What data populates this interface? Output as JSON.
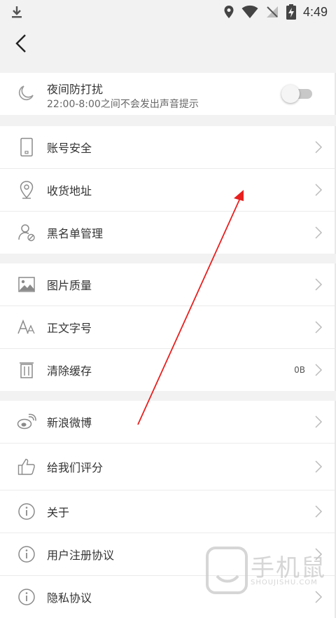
{
  "status_bar": {
    "time": "4:49",
    "icons": [
      "download-icon",
      "location-icon",
      "wifi-icon",
      "no-sim-icon",
      "battery-charging-icon"
    ]
  },
  "header": {
    "back_icon": "chevron-left-icon"
  },
  "night_mode": {
    "title": "夜间防打扰",
    "subtitle": "22:00-8:00之间不会发出声音提示",
    "enabled": false
  },
  "group1": [
    {
      "label": "账号安全",
      "icon": "phone-icon"
    },
    {
      "label": "收货地址",
      "icon": "location-pin-icon"
    },
    {
      "label": "黑名单管理",
      "icon": "user-block-icon"
    }
  ],
  "group2": [
    {
      "label": "图片质量",
      "icon": "image-icon"
    },
    {
      "label": "正文字号",
      "icon": "font-size-icon"
    },
    {
      "label": "清除缓存",
      "icon": "trash-icon",
      "value": "0B"
    }
  ],
  "group3": [
    {
      "label": "新浪微博",
      "icon": "weibo-icon"
    },
    {
      "label": "给我们评分",
      "icon": "thumbs-up-icon"
    },
    {
      "label": "关于",
      "icon": "info-icon"
    },
    {
      "label": "用户注册协议",
      "icon": "info-icon"
    },
    {
      "label": "隐私协议",
      "icon": "info-icon"
    }
  ],
  "watermark": {
    "brand": "手机鼠",
    "domain": "SHOUJISHU.COM"
  },
  "colors": {
    "background": "#f2f2f2",
    "row": "#ffffff",
    "annotation_arrow": "#e8201f",
    "icon": "#8a8a8a"
  }
}
